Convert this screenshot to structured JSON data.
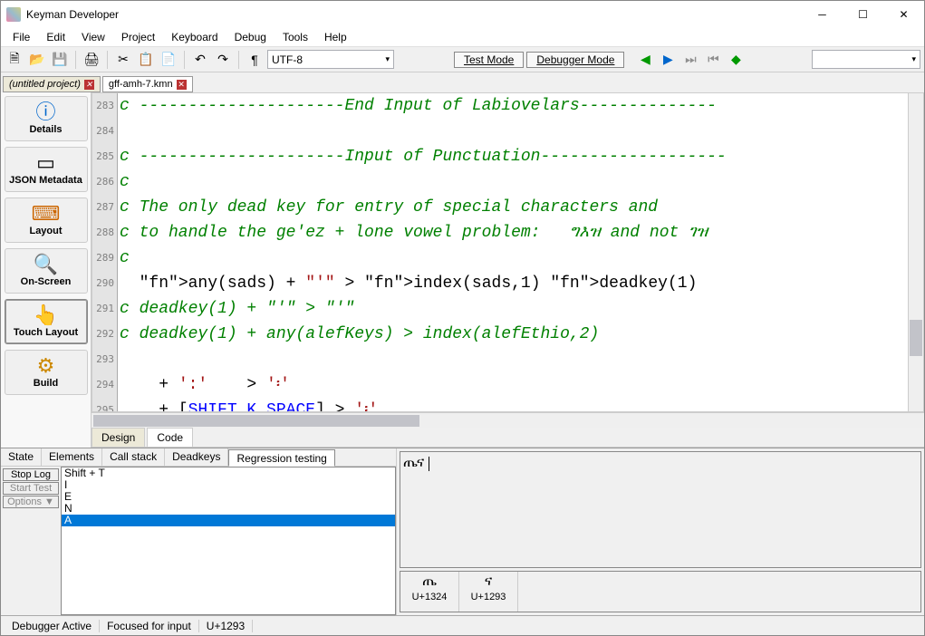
{
  "app": {
    "title": "Keyman Developer"
  },
  "menu": [
    "File",
    "Edit",
    "View",
    "Project",
    "Keyboard",
    "Debug",
    "Tools",
    "Help"
  ],
  "toolbar": {
    "encoding": "UTF-8",
    "testMode": "Test Mode",
    "debuggerMode": "Debugger Mode"
  },
  "tabs": {
    "project": "(untitled project)",
    "file": "gff-amh-7.kmn"
  },
  "sidebar": {
    "details": "Details",
    "json": "JSON Metadata",
    "layout": "Layout",
    "onscreen": "On-Screen",
    "touch": "Touch Layout",
    "build": "Build"
  },
  "editor": {
    "firstLine": 283,
    "lines": [
      "c ---------------------End Input of Labiovelars--------------",
      "",
      "c ---------------------Input of Punctuation-------------------",
      "c",
      "c The only dead key for entry of special characters and",
      "c to handle the ge'ez + lone vowel problem:   ግእዝ and not ገዝ",
      "c",
      "  any(sads) + \"'\" > index(sads,1) deadkey(1)",
      "c deadkey(1) + \"'\" > \"'\"",
      "c deadkey(1) + any(alefKeys) > index(alefEthio,2)",
      "",
      "    + ':'    > '፡'",
      "    + [SHIFT K_SPACE] > '፡'"
    ]
  },
  "edtabs": {
    "design": "Design",
    "code": "Code"
  },
  "debug": {
    "tabs": [
      "State",
      "Elements",
      "Call stack",
      "Deadkeys",
      "Regression testing"
    ],
    "stopLog": "Stop Log",
    "startTest": "Start Test",
    "options": "Options ▼",
    "keys": [
      "Shift + T",
      "I",
      "E",
      "N",
      "A"
    ],
    "preview": "ጤና",
    "chars": [
      {
        "glyph": "ጤ",
        "code": "U+1324"
      },
      {
        "glyph": "ና",
        "code": "U+1293"
      }
    ]
  },
  "status": {
    "s1": "Debugger Active",
    "s2": "Focused for input",
    "s3": "U+1293"
  }
}
